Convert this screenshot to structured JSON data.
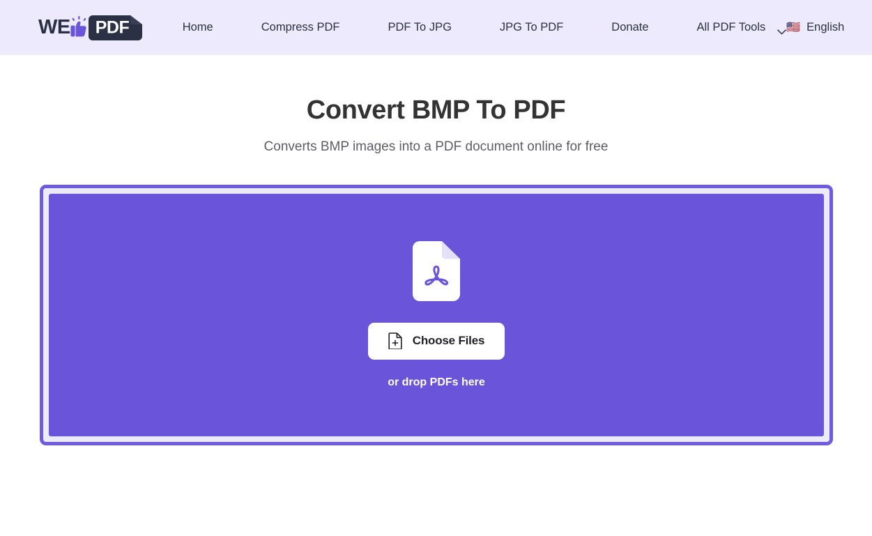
{
  "header": {
    "logo": {
      "text_left": "WE",
      "badge_text": "PDF",
      "thumb_icon": "thumbs-up-icon",
      "badge_color": "#2b3044",
      "accent_color": "#6a55da"
    },
    "nav": [
      {
        "label": "Home"
      },
      {
        "label": "Compress PDF"
      },
      {
        "label": "PDF To JPG"
      },
      {
        "label": "JPG To PDF"
      },
      {
        "label": "Donate"
      },
      {
        "label": "All PDF Tools",
        "icon": "chevron-down-icon"
      }
    ],
    "language": {
      "flag": "🇺🇸",
      "label": "English"
    },
    "background_color": "#eeeafd"
  },
  "main": {
    "title": "Convert BMP To PDF",
    "subtitle": "Converts BMP images into a PDF document online for free",
    "dropzone": {
      "file_icon": "pdf-file-icon",
      "button_icon": "file-plus-icon",
      "button_label": "Choose Files",
      "hint": "or drop PDFs here",
      "fill_color": "#6a55da",
      "border_color": "#6f5bdf"
    }
  }
}
